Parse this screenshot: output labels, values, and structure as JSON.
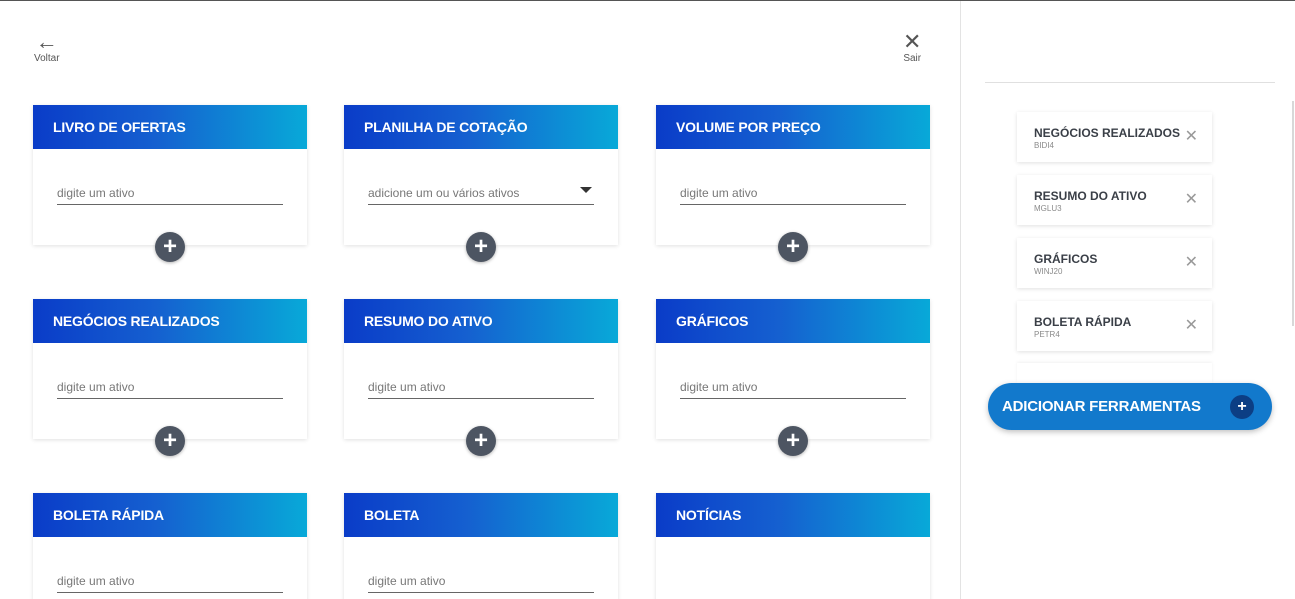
{
  "nav": {
    "back_label": "Voltar",
    "exit_label": "Sair",
    "back_icon": "arrow-left-icon",
    "exit_icon": "close-icon"
  },
  "cards": [
    {
      "title": "LIVRO DE OFERTAS",
      "placeholder": "digite um ativo"
    },
    {
      "title": "PLANILHA DE COTAÇÃO",
      "placeholder": "adicione um ou vários ativos"
    },
    {
      "title": "VOLUME POR PREÇO",
      "placeholder": "digite um ativo"
    },
    {
      "title": "NEGÓCIOS REALIZADOS",
      "placeholder": "digite um ativo"
    },
    {
      "title": "RESUMO DO ATIVO",
      "placeholder": "digite um ativo"
    },
    {
      "title": "GRÁFICOS",
      "placeholder": "digite um ativo"
    },
    {
      "title": "BOLETA RÁPIDA",
      "placeholder": "digite um ativo"
    },
    {
      "title": "BOLETA",
      "placeholder": "digite um ativo"
    },
    {
      "title": "NOTÍCIAS"
    }
  ],
  "selected_tools": [
    {
      "name": "NEGÓCIOS REALIZADOS",
      "asset": "BIDI4"
    },
    {
      "name": "RESUMO DO ATIVO",
      "asset": "MGLU3"
    },
    {
      "name": "GRÁFICOS",
      "asset": "WINJ20"
    },
    {
      "name": "BOLETA RÁPIDA",
      "asset": "PETR4"
    }
  ],
  "add_tools_label": "ADICIONAR FERRAMENTAS",
  "colors": {
    "header_gradient_start": "#0a3cc8",
    "header_gradient_end": "#08a9d8",
    "add_button": "#1279cc",
    "plus_circle": "#4d5562"
  }
}
